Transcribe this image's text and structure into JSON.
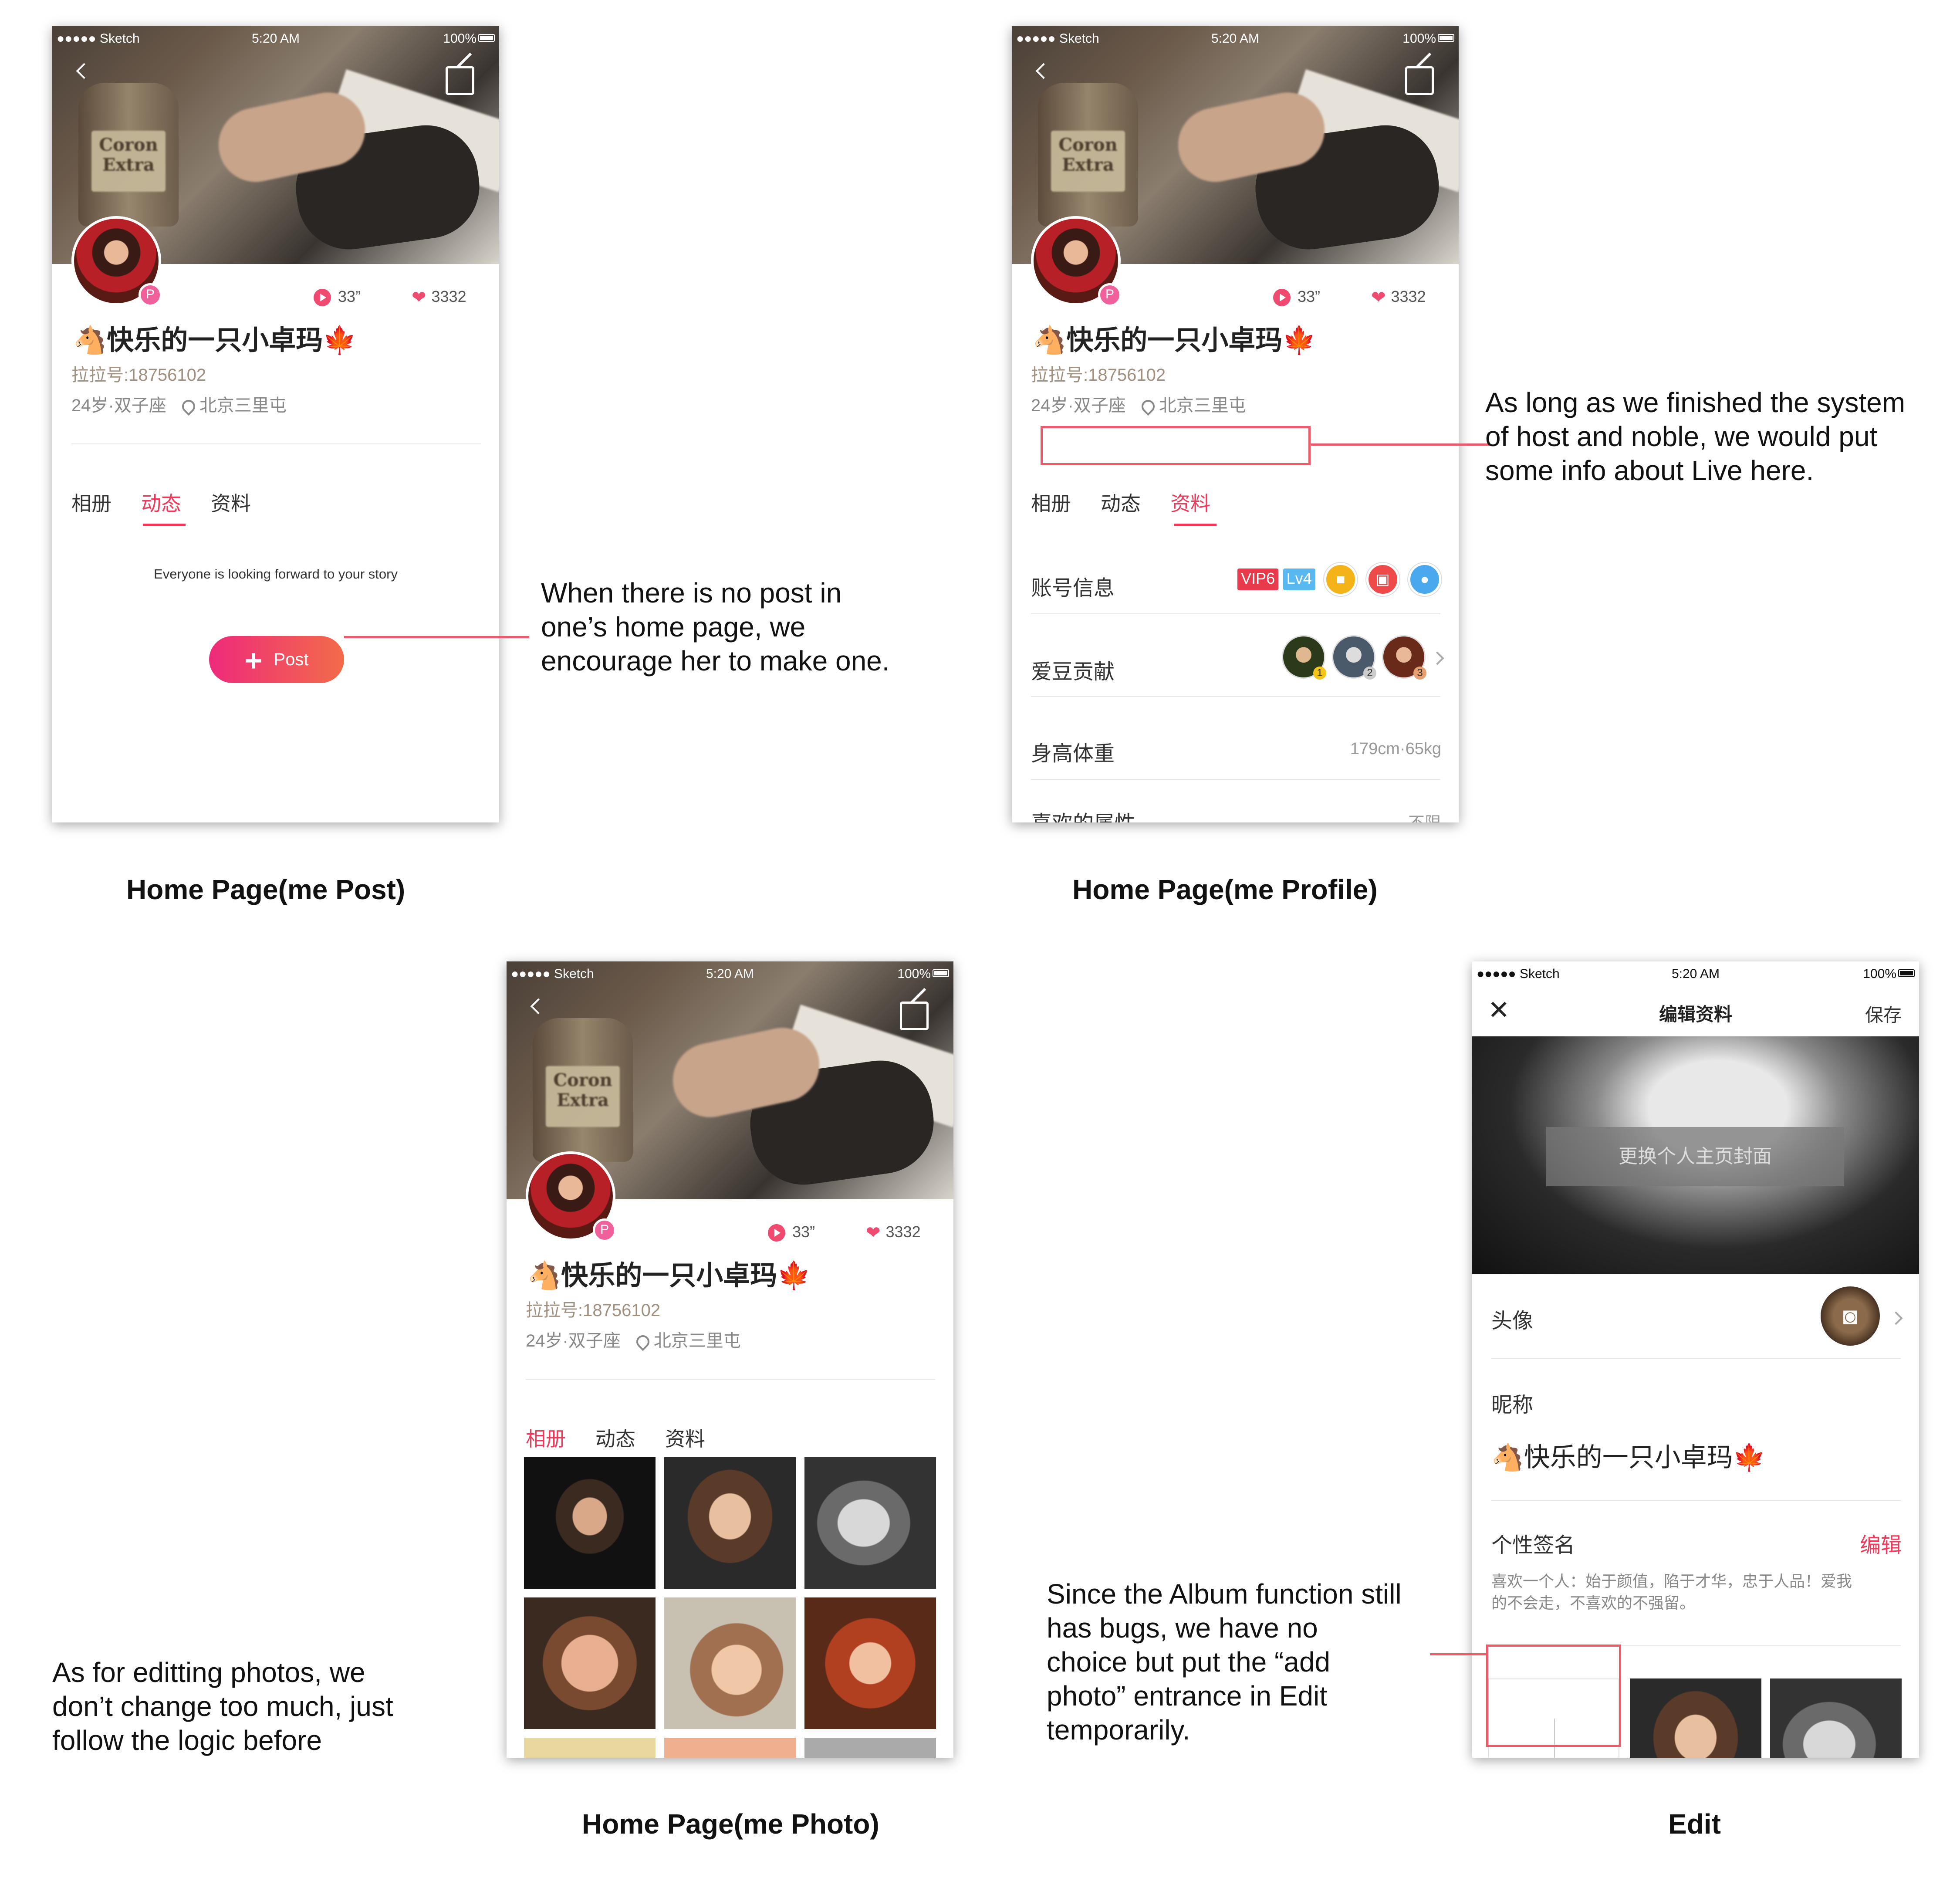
{
  "common": {
    "status_carrier": "●●●●● Sketch",
    "status_time": "5:20 AM",
    "status_battery": "100%",
    "play_count": "33”",
    "like_count": "3332",
    "verified_badge": "P",
    "name": "快乐的一只小卓玛",
    "name_left_emoji": "🐴",
    "name_right_emoji": "🍁",
    "uid": "拉拉号:18756102",
    "age_sign": "24岁·双子座",
    "location": "北京三里屯",
    "tabs": [
      "相册",
      "动态",
      "资料"
    ]
  },
  "screen_post": {
    "empty_text": "Everyone is looking forward to your story",
    "post_button": "Post",
    "caption": "Home Page(me  Post)",
    "note": [
      "When there is no post in",
      "one’s home page, we",
      "encourage her to make one."
    ]
  },
  "screen_profile": {
    "caption": "Home Page(me  Profile)",
    "rows": {
      "account_label": "账号信息",
      "vip_tag": "VIP6",
      "level_tag": "Lv4",
      "fans_label": "爱豆贡献",
      "fan_ranks": [
        "1",
        "2",
        "3"
      ],
      "height_label": "身高体重",
      "height_value": "179cm·65kg",
      "pref_label": "喜欢的属性",
      "pref_value": "不限"
    },
    "note": [
      "As long as we finished the system",
      "of host and noble, we would put",
      "some info about Live here."
    ]
  },
  "screen_photo": {
    "caption": "Home Page(me  Photo)",
    "note": [
      "As for editting photos, we",
      "don’t change too much, just",
      "follow the logic before"
    ]
  },
  "screen_edit": {
    "caption": "Edit",
    "title": "编辑资料",
    "save": "保存",
    "cover_button": "更换个人主页封面",
    "avatar_label": "头像",
    "nickname_label": "昵称",
    "nickname_value": "快乐的一只小卓玛",
    "signature_label": "个性签名",
    "signature_edit": "编辑",
    "signature_text_1": "喜欢一个人：始于颜值，陷于才华，忠于人品！爱我",
    "signature_text_2": "的不会走，不喜欢的不强留。",
    "note": [
      "Since the Album function still",
      "has bugs, we have no",
      "choice but put the “add",
      "photo” entrance in Edit",
      "temporarily."
    ]
  },
  "colors": {
    "accent": "#ef3a5a",
    "annotation": "#ef5a6a",
    "vip": "#e83a4a",
    "level": "#5ab8f0"
  }
}
